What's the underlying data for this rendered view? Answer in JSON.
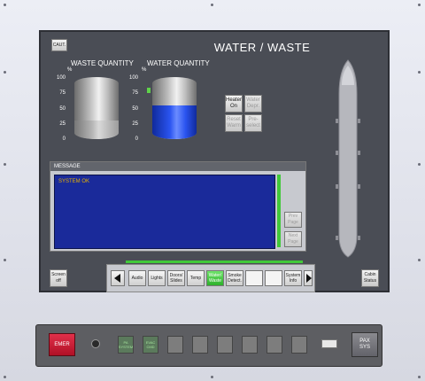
{
  "screen": {
    "title": "WATER / WASTE",
    "caut_button": "CAUT.",
    "waste_quantity": {
      "label": "WASTE QUANTITY",
      "unit": "%",
      "ticks": [
        "100",
        "75",
        "50",
        "25",
        "0"
      ],
      "level_percent": 30
    },
    "water_quantity": {
      "label": "WATER QUANTITY",
      "unit": "%",
      "ticks": [
        "100",
        "75",
        "50",
        "25",
        "0"
      ],
      "level_percent": 55
    },
    "controls": [
      {
        "label": "Heater\nOn",
        "enabled": true
      },
      {
        "label": "Water\nDepr.",
        "enabled": false
      },
      {
        "label": "Reset\nWarm",
        "enabled": false
      },
      {
        "label": "Pre-\nselect",
        "enabled": false
      }
    ],
    "message": {
      "header": "MESSAGE",
      "text": "SYSTEM OK",
      "prev_page": "Prev\nPage",
      "next_page": "Next\nPage"
    },
    "screen_off": "Screen\noff",
    "cabin_status": "Cabin\nStatus",
    "nav_items": [
      {
        "label": "Audio",
        "active": false
      },
      {
        "label": "Lights",
        "active": false
      },
      {
        "label": "Doors/\nSlides",
        "active": false
      },
      {
        "label": "Temp",
        "active": false
      },
      {
        "label": "Water/\nWaste",
        "active": true
      },
      {
        "label": "Smoke\nDetect.",
        "active": false
      },
      {
        "label": "",
        "active": false
      },
      {
        "label": "",
        "active": false
      },
      {
        "label": "System\nInfo",
        "active": false
      }
    ]
  },
  "hardware": {
    "emer": "EMER",
    "pax_sys": "PAX\nSYS",
    "keys": [
      {
        "label": "PA\nSYSTEM",
        "lit": true
      },
      {
        "label": "EVAC\nCMD",
        "lit": true
      },
      {
        "label": "",
        "lit": false
      },
      {
        "label": "",
        "lit": false
      },
      {
        "label": "",
        "lit": false
      },
      {
        "label": "",
        "lit": false
      },
      {
        "label": "",
        "lit": false
      },
      {
        "label": "",
        "lit": false
      }
    ]
  },
  "colors": {
    "active_tab": "#2db02a",
    "message_bg": "#1a2a9a",
    "message_text": "#e8b200",
    "water_fill": "#2a54f0"
  }
}
